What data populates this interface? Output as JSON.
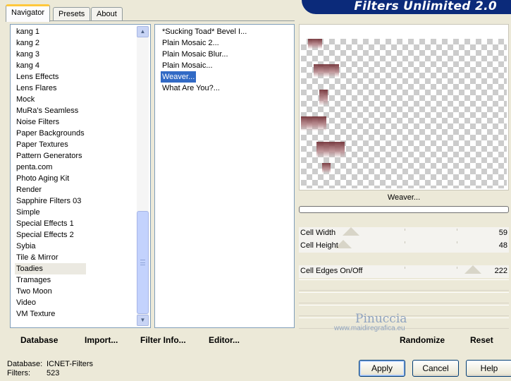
{
  "tabs": [
    "Navigator",
    "Presets",
    "About"
  ],
  "banner": "Filters Unlimited 2.0",
  "categories": [
    "kang 1",
    "kang 2",
    "kang 3",
    "kang 4",
    "Lens Effects",
    "Lens Flares",
    "Mock",
    "MuRa's Seamless",
    "Noise Filters",
    "Paper Backgrounds",
    "Paper Textures",
    "Pattern Generators",
    "penta.com",
    "Photo Aging Kit",
    "Render",
    "Sapphire Filters 03",
    "Simple",
    "Special Effects 1",
    "Special Effects 2",
    "Sybia",
    "Tile & Mirror",
    "Toadies",
    "Tramages",
    "Two Moon",
    "Video",
    "VM Texture"
  ],
  "selected_category": "Toadies",
  "filters": [
    "*Sucking Toad*  Bevel I...",
    "Plain Mosaic 2...",
    "Plain Mosaic Blur...",
    "Plain Mosaic...",
    "Weaver...",
    "What Are You?..."
  ],
  "selected_filter": "Weaver...",
  "preview_filter_name": "Weaver...",
  "params": [
    {
      "label": "Cell Width",
      "value": "59",
      "max": 255
    },
    {
      "label": "Cell Height",
      "value": "48",
      "max": 255
    },
    {
      "label": "Cell Edges On/Off",
      "value": "222",
      "max": 255
    }
  ],
  "watermark": {
    "name": "Pinuccia",
    "url": "www.maidiregrafica.eu"
  },
  "bottom_left": {
    "database": "Database",
    "import": "Import...",
    "filter_info": "Filter Info...",
    "editor": "Editor..."
  },
  "bottom_right": {
    "randomize": "Randomize",
    "reset": "Reset"
  },
  "status": {
    "database_label": "Database:",
    "database_value": "ICNET-Filters",
    "filters_label": "Filters:",
    "filters_value": "523"
  },
  "buttons": {
    "apply": "Apply",
    "cancel": "Cancel",
    "help": "Help"
  }
}
